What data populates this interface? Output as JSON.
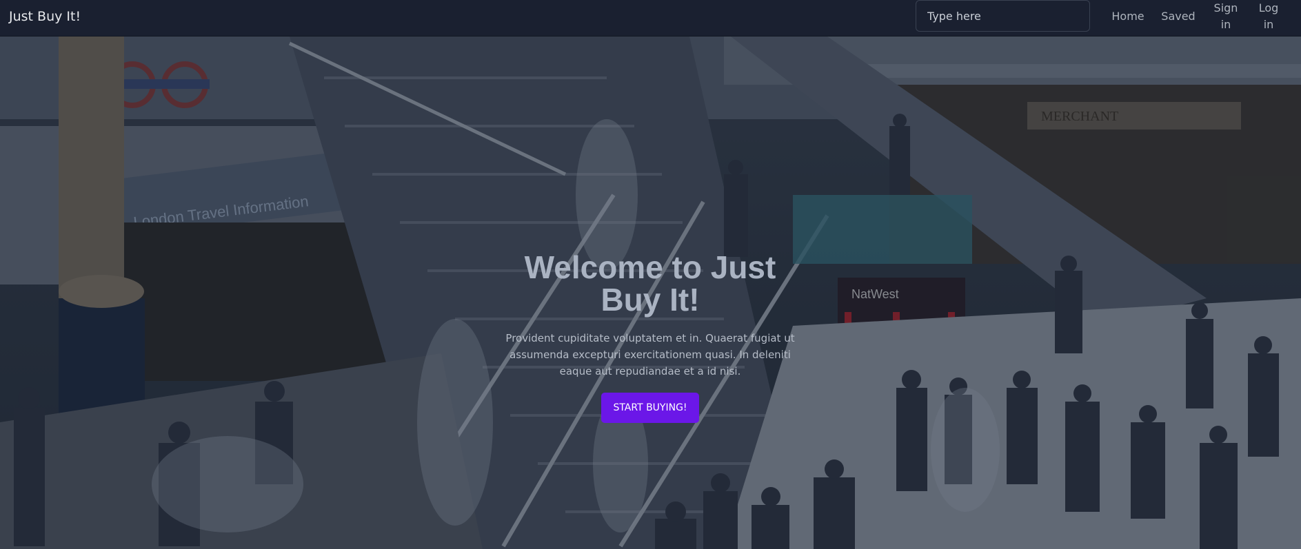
{
  "navbar": {
    "brand": "Just Buy It!",
    "search_placeholder": "Type here",
    "links": {
      "home": "Home",
      "saved": "Saved",
      "sign_in": "Sign in",
      "log_in": "Log in"
    }
  },
  "hero": {
    "title": "Welcome to Just Buy It!",
    "description": "Provident cupiditate voluptatem et in. Quaerat fugiat ut assumenda excepturi exercitationem quasi. In deleniti eaque aut repudiandae et a id nisi.",
    "cta_label": "START BUYING!",
    "background_image": "busy-train-station-photo",
    "sign_text_left": "London Travel Information",
    "sign_text_right": "MERCHANT",
    "sign_text_bank": "NatWest"
  },
  "colors": {
    "navbar_bg": "#1a2030",
    "cta_bg": "#6b17e8",
    "title": "#aab3c2"
  }
}
